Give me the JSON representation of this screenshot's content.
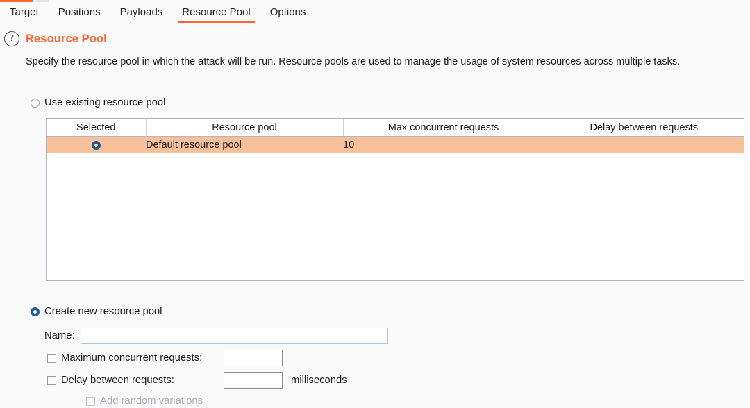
{
  "tabs": [
    {
      "label": "Target",
      "active": false
    },
    {
      "label": "Positions",
      "active": false
    },
    {
      "label": "Payloads",
      "active": false
    },
    {
      "label": "Resource Pool",
      "active": true
    },
    {
      "label": "Options",
      "active": false
    }
  ],
  "header": {
    "help_icon": "question-mark-icon",
    "help_glyph": "?",
    "title": "Resource Pool",
    "title_color": "#ff6633"
  },
  "description": "Specify the resource pool in which the attack will be run. Resource pools are used to manage the usage of system resources across multiple tasks.",
  "use_existing": {
    "label": "Use existing resource pool",
    "selected": false
  },
  "table": {
    "columns": [
      "Selected",
      "Resource pool",
      "Max concurrent requests",
      "Delay between requests"
    ],
    "rows": [
      {
        "selected": true,
        "resource_pool": "Default resource pool",
        "max_concurrent_requests": "10",
        "delay_between_requests": ""
      }
    ]
  },
  "create_new": {
    "label": "Create new resource pool",
    "selected": true,
    "name_label": "Name:",
    "name_value": "",
    "name_placeholder": "",
    "max_concurrent": {
      "label": "Maximum concurrent requests:",
      "checked": false,
      "value": "",
      "placeholder": ""
    },
    "delay": {
      "label": "Delay between requests:",
      "checked": false,
      "value": "",
      "placeholder": "",
      "unit": "milliseconds"
    },
    "random_variations": {
      "label": "Add random variations",
      "checked": false,
      "disabled": true
    }
  },
  "colors": {
    "accent_orange": "#ff6633",
    "row_highlight": "#f8c09a",
    "radio_blue": "#1c5c94",
    "background": "#fafafa"
  }
}
